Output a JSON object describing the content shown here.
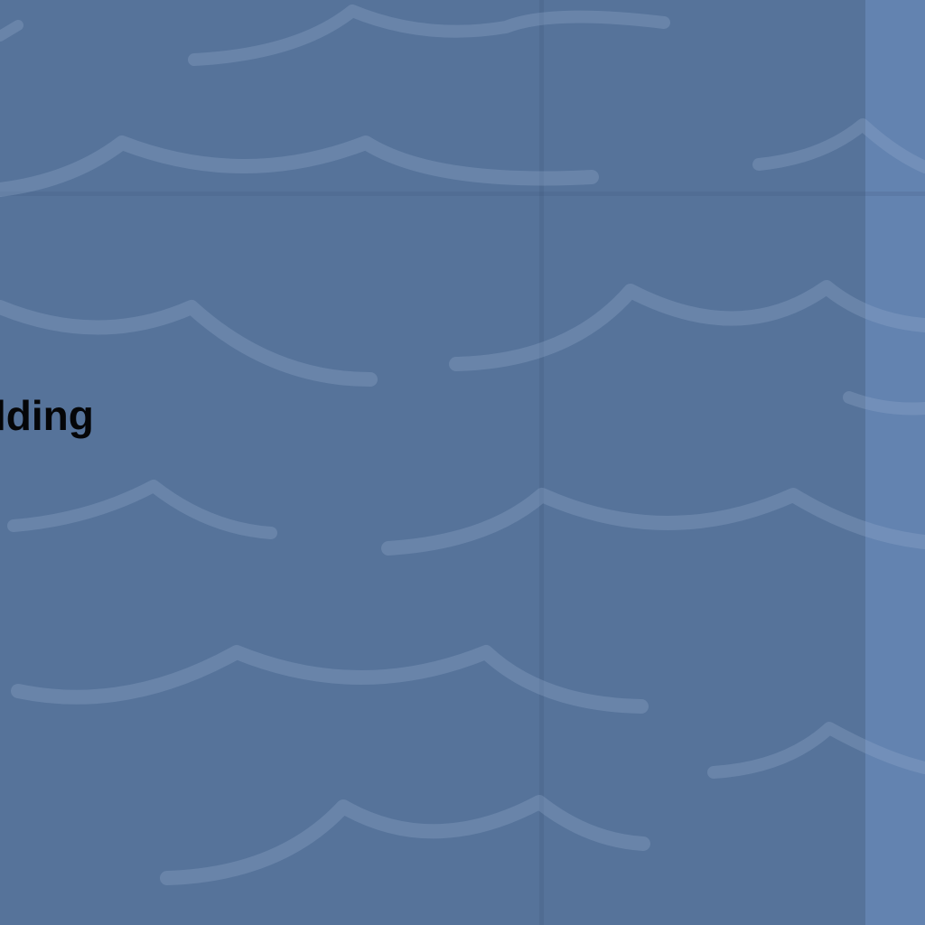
{
  "map": {
    "place_label": "lding",
    "colors": {
      "water": "#56739a",
      "water_edge_tile": "#6383b0",
      "wave_pattern": "#96accd",
      "label": "#050608"
    },
    "pattern": "wave-pattern"
  }
}
